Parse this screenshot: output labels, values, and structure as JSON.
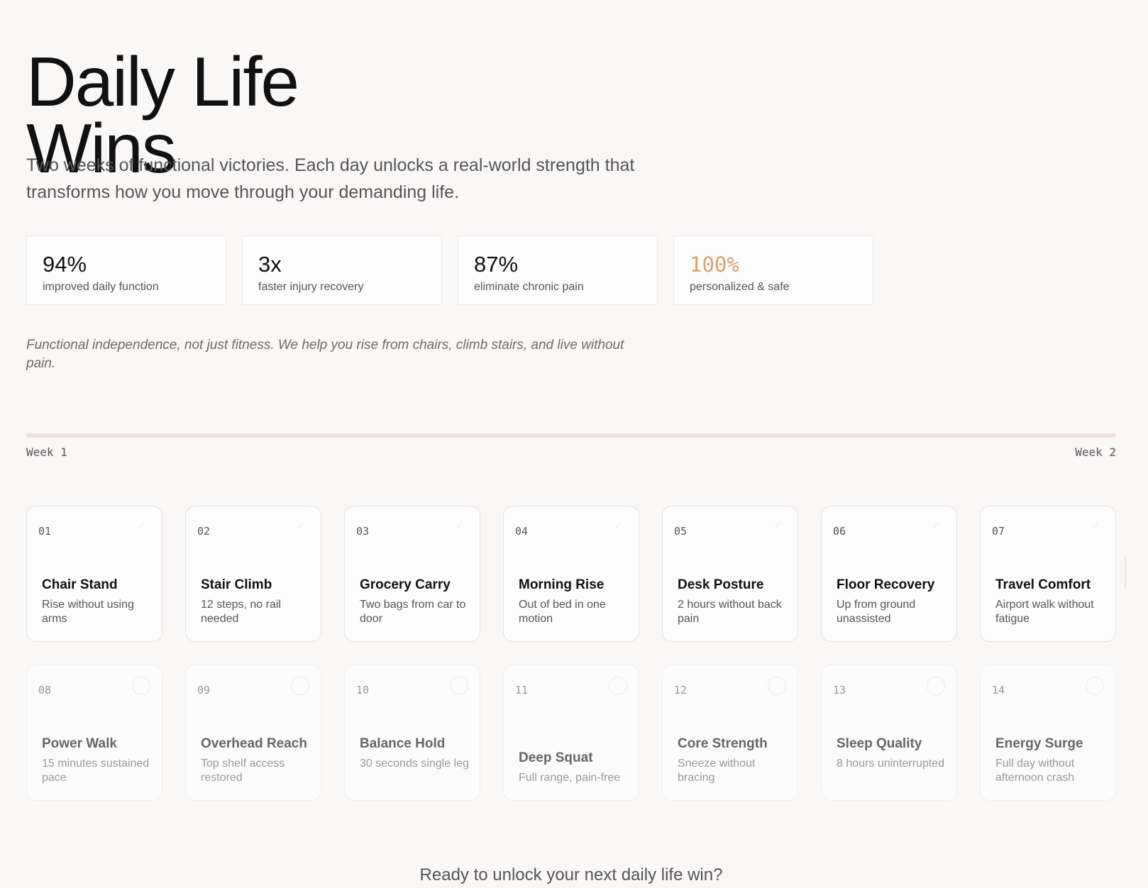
{
  "header": {
    "title_line1": "Daily Life",
    "title_line2": "Wins",
    "subtitle": "Two weeks of functional victories. Each day unlocks a real-world strength that transforms how you move through your demanding life."
  },
  "stats": [
    {
      "value": "94%",
      "label": "improved daily function"
    },
    {
      "value": "3x",
      "label": "faster injury recovery"
    },
    {
      "value": "87%",
      "label": "eliminate chronic pain"
    },
    {
      "value": "100%",
      "label": "personalized & safe"
    }
  ],
  "tagline": "Functional independence, not just fitness. We help you rise from chairs, climb stairs, and live without pain.",
  "timeline": {
    "week1_label": "Week 1",
    "week2_label": "Week 2"
  },
  "days": [
    {
      "num": "01",
      "title": "Chair Stand",
      "desc": "Rise without using arms",
      "status": "done"
    },
    {
      "num": "02",
      "title": "Stair Climb",
      "desc": "12 steps, no rail needed",
      "status": "done"
    },
    {
      "num": "03",
      "title": "Grocery Carry",
      "desc": "Two bags from car to door",
      "status": "done"
    },
    {
      "num": "04",
      "title": "Morning Rise",
      "desc": "Out of bed in one motion",
      "status": "done"
    },
    {
      "num": "05",
      "title": "Desk Posture",
      "desc": "2 hours without back pain",
      "status": "done"
    },
    {
      "num": "06",
      "title": "Floor Recovery",
      "desc": "Up from ground unassisted",
      "status": "done"
    },
    {
      "num": "07",
      "title": "Travel Comfort",
      "desc": "Airport walk without fatigue",
      "status": "done"
    },
    {
      "num": "08",
      "title": "Power Walk",
      "desc": "15 minutes sustained pace",
      "status": "pending"
    },
    {
      "num": "09",
      "title": "Overhead Reach",
      "desc": "Top shelf access restored",
      "status": "pending"
    },
    {
      "num": "10",
      "title": "Balance Hold",
      "desc": "30 seconds single leg",
      "status": "pending"
    },
    {
      "num": "11",
      "title": "Deep Squat",
      "desc": "Full range, pain-free",
      "status": "pending"
    },
    {
      "num": "12",
      "title": "Core Strength",
      "desc": "Sneeze without bracing",
      "status": "pending"
    },
    {
      "num": "13",
      "title": "Sleep Quality",
      "desc": "8 hours uninterrupted",
      "status": "pending"
    },
    {
      "num": "14",
      "title": "Energy Surge",
      "desc": "Full day without afternoon crash",
      "status": "pending"
    }
  ],
  "cta": "Ready to unlock your next daily life win?",
  "colors": {
    "accent": "#dca06a",
    "track": "#eedee1",
    "background": "#faf7f7"
  },
  "icons": {
    "done": "check-icon",
    "pending": "circle-icon"
  }
}
